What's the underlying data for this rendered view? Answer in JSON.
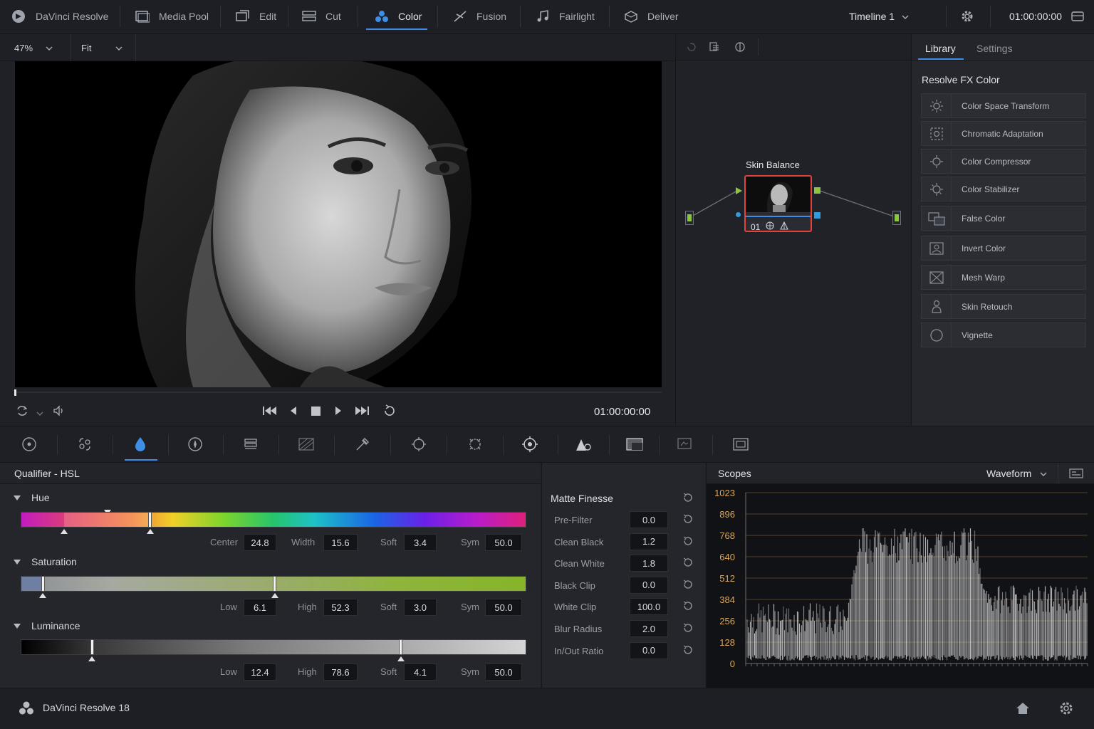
{
  "top_bar": {
    "app_name": "DaVinci Resolve",
    "tabs": [
      {
        "label": "Media Pool",
        "icon": "media-pool-icon"
      },
      {
        "label": "Edit",
        "icon": "edit-icon"
      },
      {
        "label": "Cut",
        "icon": "cut-icon"
      },
      {
        "label": "Color",
        "icon": "color-icon",
        "active": true
      },
      {
        "label": "Fusion",
        "icon": "fusion-icon"
      },
      {
        "label": "Fairlight",
        "icon": "fairlight-icon"
      },
      {
        "label": "Deliver",
        "icon": "deliver-icon"
      }
    ],
    "timeline": "Timeline 1",
    "timecode": "01:00:00:00"
  },
  "viewer": {
    "zoom": "47%",
    "fit": "Fit",
    "timecode": "01:00:00:00"
  },
  "node_graph": {
    "node_label": "Skin Balance",
    "node_number": "01"
  },
  "library": {
    "tabs": [
      "Library",
      "Settings"
    ],
    "section_title": "Resolve FX Color",
    "items": [
      "Color Space Transform",
      "Chromatic Adaptation",
      "Color Compressor",
      "Color Stabilizer",
      "False Color",
      "Invert Color",
      "Mesh Warp",
      "Skin Retouch",
      "Vignette"
    ]
  },
  "qualifier": {
    "title": "Qualifier - HSL",
    "hue": {
      "label": "Hue",
      "center_label": "Center",
      "center": "24.8",
      "width_label": "Width",
      "width": "15.6",
      "soft_label": "Soft",
      "soft": "3.4",
      "sym_label": "Sym",
      "sym": "50.0"
    },
    "saturation": {
      "label": "Saturation",
      "low_label": "Low",
      "low": "6.1",
      "high_label": "High",
      "high": "52.3",
      "soft_label": "Soft",
      "soft": "3.0",
      "sym_label": "Sym",
      "sym": "50.0"
    },
    "luminance": {
      "label": "Luminance",
      "low_label": "Low",
      "low": "12.4",
      "high_label": "High",
      "high": "78.6",
      "soft_label": "Soft",
      "soft": "4.1",
      "sym_label": "Sym",
      "sym": "50.0"
    }
  },
  "matte_finesse": {
    "title": "Matte Finesse",
    "rows": [
      {
        "label": "Pre-Filter",
        "value": "0.0"
      },
      {
        "label": "Clean Black",
        "value": "1.2"
      },
      {
        "label": "Clean White",
        "value": "1.8"
      },
      {
        "label": "Black Clip",
        "value": "0.0"
      },
      {
        "label": "White Clip",
        "value": "100.0"
      },
      {
        "label": "Blur Radius",
        "value": "2.0"
      },
      {
        "label": "In/Out Ratio",
        "value": "0.0"
      }
    ]
  },
  "scopes": {
    "title": "Scopes",
    "mode": "Waveform",
    "scale": [
      "1023",
      "896",
      "768",
      "640",
      "512",
      "384",
      "256",
      "128",
      "0"
    ]
  },
  "footer": {
    "label": "DaVinci Resolve 18"
  },
  "colors": {
    "accent": "#3e8ee6",
    "node_border": "#e0443a",
    "node_green": "#8cc63f",
    "node_blue": "#2f9be0",
    "scope_gridline": "#8a6a35"
  }
}
